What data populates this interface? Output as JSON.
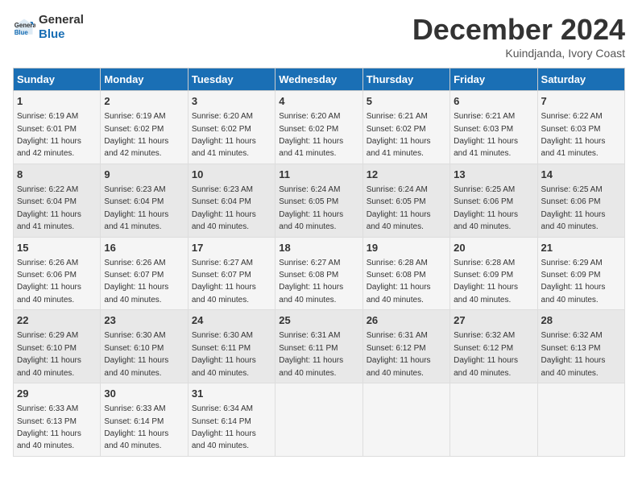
{
  "logo": {
    "line1": "General",
    "line2": "Blue"
  },
  "title": "December 2024",
  "location": "Kuindjanda, Ivory Coast",
  "days_of_week": [
    "Sunday",
    "Monday",
    "Tuesday",
    "Wednesday",
    "Thursday",
    "Friday",
    "Saturday"
  ],
  "weeks": [
    [
      {
        "day": "1",
        "sunrise": "6:19 AM",
        "sunset": "6:01 PM",
        "daylight": "11 hours and 42 minutes."
      },
      {
        "day": "2",
        "sunrise": "6:19 AM",
        "sunset": "6:02 PM",
        "daylight": "11 hours and 42 minutes."
      },
      {
        "day": "3",
        "sunrise": "6:20 AM",
        "sunset": "6:02 PM",
        "daylight": "11 hours and 41 minutes."
      },
      {
        "day": "4",
        "sunrise": "6:20 AM",
        "sunset": "6:02 PM",
        "daylight": "11 hours and 41 minutes."
      },
      {
        "day": "5",
        "sunrise": "6:21 AM",
        "sunset": "6:02 PM",
        "daylight": "11 hours and 41 minutes."
      },
      {
        "day": "6",
        "sunrise": "6:21 AM",
        "sunset": "6:03 PM",
        "daylight": "11 hours and 41 minutes."
      },
      {
        "day": "7",
        "sunrise": "6:22 AM",
        "sunset": "6:03 PM",
        "daylight": "11 hours and 41 minutes."
      }
    ],
    [
      {
        "day": "8",
        "sunrise": "6:22 AM",
        "sunset": "6:04 PM",
        "daylight": "11 hours and 41 minutes."
      },
      {
        "day": "9",
        "sunrise": "6:23 AM",
        "sunset": "6:04 PM",
        "daylight": "11 hours and 41 minutes."
      },
      {
        "day": "10",
        "sunrise": "6:23 AM",
        "sunset": "6:04 PM",
        "daylight": "11 hours and 40 minutes."
      },
      {
        "day": "11",
        "sunrise": "6:24 AM",
        "sunset": "6:05 PM",
        "daylight": "11 hours and 40 minutes."
      },
      {
        "day": "12",
        "sunrise": "6:24 AM",
        "sunset": "6:05 PM",
        "daylight": "11 hours and 40 minutes."
      },
      {
        "day": "13",
        "sunrise": "6:25 AM",
        "sunset": "6:06 PM",
        "daylight": "11 hours and 40 minutes."
      },
      {
        "day": "14",
        "sunrise": "6:25 AM",
        "sunset": "6:06 PM",
        "daylight": "11 hours and 40 minutes."
      }
    ],
    [
      {
        "day": "15",
        "sunrise": "6:26 AM",
        "sunset": "6:06 PM",
        "daylight": "11 hours and 40 minutes."
      },
      {
        "day": "16",
        "sunrise": "6:26 AM",
        "sunset": "6:07 PM",
        "daylight": "11 hours and 40 minutes."
      },
      {
        "day": "17",
        "sunrise": "6:27 AM",
        "sunset": "6:07 PM",
        "daylight": "11 hours and 40 minutes."
      },
      {
        "day": "18",
        "sunrise": "6:27 AM",
        "sunset": "6:08 PM",
        "daylight": "11 hours and 40 minutes."
      },
      {
        "day": "19",
        "sunrise": "6:28 AM",
        "sunset": "6:08 PM",
        "daylight": "11 hours and 40 minutes."
      },
      {
        "day": "20",
        "sunrise": "6:28 AM",
        "sunset": "6:09 PM",
        "daylight": "11 hours and 40 minutes."
      },
      {
        "day": "21",
        "sunrise": "6:29 AM",
        "sunset": "6:09 PM",
        "daylight": "11 hours and 40 minutes."
      }
    ],
    [
      {
        "day": "22",
        "sunrise": "6:29 AM",
        "sunset": "6:10 PM",
        "daylight": "11 hours and 40 minutes."
      },
      {
        "day": "23",
        "sunrise": "6:30 AM",
        "sunset": "6:10 PM",
        "daylight": "11 hours and 40 minutes."
      },
      {
        "day": "24",
        "sunrise": "6:30 AM",
        "sunset": "6:11 PM",
        "daylight": "11 hours and 40 minutes."
      },
      {
        "day": "25",
        "sunrise": "6:31 AM",
        "sunset": "6:11 PM",
        "daylight": "11 hours and 40 minutes."
      },
      {
        "day": "26",
        "sunrise": "6:31 AM",
        "sunset": "6:12 PM",
        "daylight": "11 hours and 40 minutes."
      },
      {
        "day": "27",
        "sunrise": "6:32 AM",
        "sunset": "6:12 PM",
        "daylight": "11 hours and 40 minutes."
      },
      {
        "day": "28",
        "sunrise": "6:32 AM",
        "sunset": "6:13 PM",
        "daylight": "11 hours and 40 minutes."
      }
    ],
    [
      {
        "day": "29",
        "sunrise": "6:33 AM",
        "sunset": "6:13 PM",
        "daylight": "11 hours and 40 minutes."
      },
      {
        "day": "30",
        "sunrise": "6:33 AM",
        "sunset": "6:14 PM",
        "daylight": "11 hours and 40 minutes."
      },
      {
        "day": "31",
        "sunrise": "6:34 AM",
        "sunset": "6:14 PM",
        "daylight": "11 hours and 40 minutes."
      },
      null,
      null,
      null,
      null
    ]
  ]
}
